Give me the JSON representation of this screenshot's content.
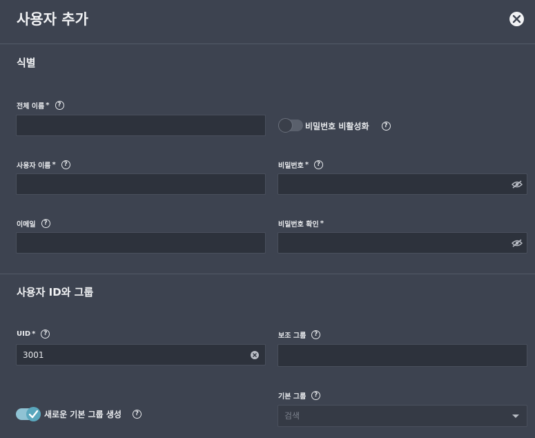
{
  "dialog": {
    "title": "사용자 추가"
  },
  "identity": {
    "title": "식별",
    "full_name": {
      "label": "전체 이름",
      "required": "*",
      "value": ""
    },
    "disable_password": {
      "label": "비밀번호 비활성화",
      "checked": false
    },
    "username": {
      "label": "사용자 이름",
      "required": "*",
      "value": ""
    },
    "password": {
      "label": "비밀번호",
      "required": "*",
      "value": ""
    },
    "email": {
      "label": "이메일",
      "value": ""
    },
    "confirm_password": {
      "label": "비밀번호 확인",
      "required": "*",
      "value": ""
    }
  },
  "ids_groups": {
    "title": "사용자 ID와 그룹",
    "uid": {
      "label": "UID",
      "required": "*",
      "value": "3001"
    },
    "aux_groups": {
      "label": "보조 그룹",
      "value": ""
    },
    "create_primary_group": {
      "label": "새로운 기본 그룹 생성",
      "checked": true
    },
    "primary_group": {
      "label": "기본 그룹",
      "placeholder": "검색"
    }
  },
  "help_glyph": "?",
  "icons": {
    "close": "close-icon",
    "help": "help-circle-icon",
    "eye_off": "eye-off-icon",
    "clear": "clear-icon",
    "dropdown": "caret-down-icon"
  },
  "colors": {
    "background": "#3d4350",
    "field": "#2d323c",
    "toggle_on": "#5aa7bd",
    "text": "#e8eaed"
  }
}
